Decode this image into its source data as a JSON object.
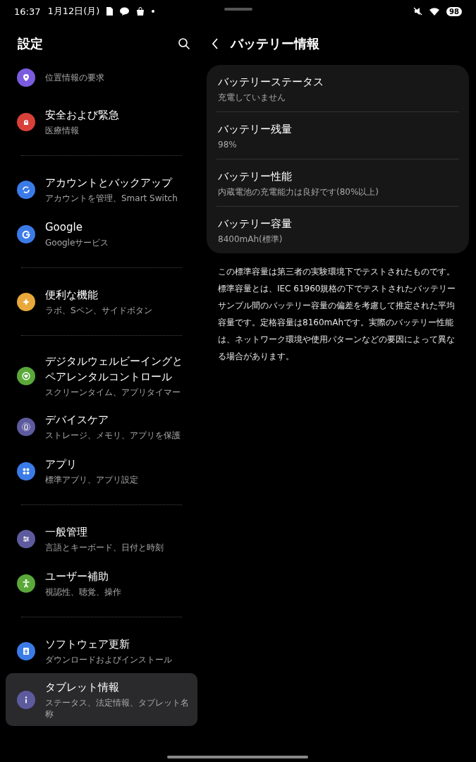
{
  "status_bar": {
    "time": "16:37",
    "date": "1月12日(月)",
    "battery": "98"
  },
  "settings": {
    "title": "設定",
    "sections": [
      {
        "items": [
          {
            "subtitle": "位置情報の要求",
            "color": "#7b5ce0",
            "selected": false
          },
          {
            "title": "安全および緊急",
            "subtitle": "医療情報",
            "color": "#d9403a",
            "selected": false
          }
        ]
      },
      {
        "items": [
          {
            "title": "アカウントとバックアップ",
            "subtitle": "アカウントを管理、Smart Switch",
            "color": "#3b7be8",
            "selected": false
          },
          {
            "title": "Google",
            "subtitle": "Googleサービス",
            "color": "#3b7be8",
            "selected": false
          }
        ]
      },
      {
        "items": [
          {
            "title": "便利な機能",
            "subtitle": "ラボ、Sペン、サイドボタン",
            "color": "#e8a83b",
            "selected": false
          }
        ]
      },
      {
        "items": [
          {
            "title": "デジタルウェルビーイングとペアレンタルコントロール",
            "subtitle": "スクリーンタイム、アプリタイマー",
            "color": "#5aa83a",
            "selected": false
          },
          {
            "title": "デバイスケア",
            "subtitle": "ストレージ、メモリ、アプリを保護",
            "color": "#5e5a9e",
            "selected": false
          },
          {
            "title": "アプリ",
            "subtitle": "標準アプリ、アプリ設定",
            "color": "#3b7be8",
            "selected": false
          }
        ]
      },
      {
        "items": [
          {
            "title": "一般管理",
            "subtitle": "言語とキーボード、日付と時刻",
            "color": "#5e5a9e",
            "selected": false
          },
          {
            "title": "ユーザー補助",
            "subtitle": "視認性、聴覚、操作",
            "color": "#5aa83a",
            "selected": false
          }
        ]
      },
      {
        "items": [
          {
            "title": "ソフトウェア更新",
            "subtitle": "ダウンロードおよびインストール",
            "color": "#3b7be8",
            "selected": false
          },
          {
            "title": "タブレット情報",
            "subtitle": "ステータス、法定情報、タブレット名称",
            "color": "#5e5a9e",
            "selected": true
          }
        ]
      }
    ]
  },
  "battery_info": {
    "title": "バッテリー情報",
    "rows": [
      {
        "title": "バッテリーステータス",
        "value": "充電していません"
      },
      {
        "title": "バッテリー残量",
        "value": "98%"
      },
      {
        "title": "バッテリー性能",
        "value": "内蔵電池の充電能力は良好です(80%以上)"
      },
      {
        "title": "バッテリー容量",
        "value": "8400mAh(標準)"
      }
    ],
    "note": "この標準容量は第三者の実験環境下でテストされたものです。標準容量とは、IEC 61960規格の下でテストされたバッテリーサンプル間のバッテリー容量の偏差を考慮して推定された平均容量です。定格容量は8160mAhです。実際のバッテリー性能は、ネットワーク環境や使用パターンなどの要因によって異なる場合があります。"
  }
}
